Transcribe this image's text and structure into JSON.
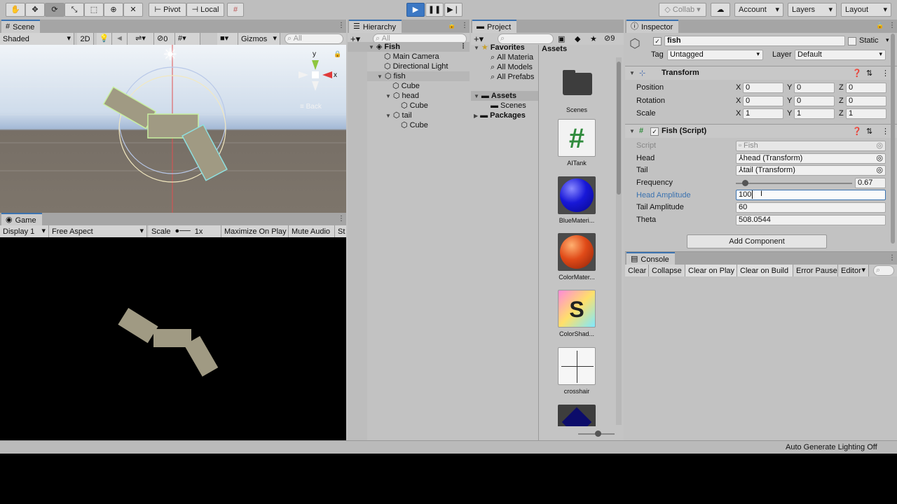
{
  "toolbar": {
    "pivot": "Pivot",
    "local": "Local",
    "collab": "Collab",
    "account": "Account",
    "layers": "Layers",
    "layout": "Layout"
  },
  "scene": {
    "tab": "Scene",
    "shading": "Shaded",
    "mode2d": "2D",
    "hidden_count": "0",
    "gizmos": "Gizmos",
    "search_placeholder": "All",
    "back_label": "≡ Back",
    "gizmo_y": "y",
    "gizmo_x": "x"
  },
  "game": {
    "tab": "Game",
    "display": "Display 1",
    "aspect": "Free Aspect",
    "scale_label": "Scale",
    "scale_value": "1x",
    "maximize": "Maximize On Play",
    "mute": "Mute Audio",
    "stats": "St"
  },
  "hierarchy": {
    "tab": "Hierarchy",
    "search_placeholder": "All",
    "items": [
      {
        "label": "Fish"
      },
      {
        "label": "Main Camera"
      },
      {
        "label": "Directional Light"
      },
      {
        "label": "fish"
      },
      {
        "label": "Cube"
      },
      {
        "label": "head"
      },
      {
        "label": "Cube"
      },
      {
        "label": "tail"
      },
      {
        "label": "Cube"
      }
    ]
  },
  "project": {
    "tab": "Project",
    "hidden_count": "9",
    "favorites": "Favorites",
    "fav_items": [
      "All Materia",
      "All Models",
      "All Prefabs"
    ],
    "assets": "Assets",
    "scenes": "Scenes",
    "packages": "Packages",
    "breadcrumb": "Assets",
    "asset_items": [
      {
        "label": "Scenes"
      },
      {
        "label": "AITank"
      },
      {
        "label": "BlueMateri..."
      },
      {
        "label": "ColorMater..."
      },
      {
        "label": "ColorShad..."
      },
      {
        "label": "crosshair"
      }
    ]
  },
  "inspector": {
    "tab": "Inspector",
    "object_name": "fish",
    "static_label": "Static",
    "tag_label": "Tag",
    "tag_value": "Untagged",
    "layer_label": "Layer",
    "layer_value": "Default",
    "transform": {
      "title": "Transform",
      "rows": [
        {
          "label": "Position",
          "x": "0",
          "y": "0",
          "z": "0"
        },
        {
          "label": "Rotation",
          "x": "0",
          "y": "0",
          "z": "0"
        },
        {
          "label": "Scale",
          "x": "1",
          "y": "1",
          "z": "1"
        }
      ]
    },
    "script": {
      "title": "Fish (Script)",
      "script_label": "Script",
      "script_value": "Fish",
      "head_label": "Head",
      "head_value": "head (Transform)",
      "tail_label": "Tail",
      "tail_value": "tail (Transform)",
      "frequency_label": "Frequency",
      "frequency_value": "0.67",
      "frequency_fraction": 0.06,
      "head_amp_label": "Head Amplitude",
      "head_amp_value": "100",
      "tail_amp_label": "Tail Amplitude",
      "tail_amp_value": "60",
      "theta_label": "Theta",
      "theta_value": "508.0544"
    },
    "add_component": "Add Component"
  },
  "console": {
    "tab": "Console",
    "buttons": [
      "Clear",
      "Collapse",
      "Clear on Play",
      "Clear on Build",
      "Error Pause",
      "Editor"
    ]
  },
  "status": {
    "text": "Auto Generate Lighting Off"
  },
  "colors": {
    "accent": "#3a72b0",
    "play": "#3c78c4",
    "scene_sky": "#a4b9d6",
    "scene_ground": "#776f66",
    "fish": "#a09a83"
  }
}
